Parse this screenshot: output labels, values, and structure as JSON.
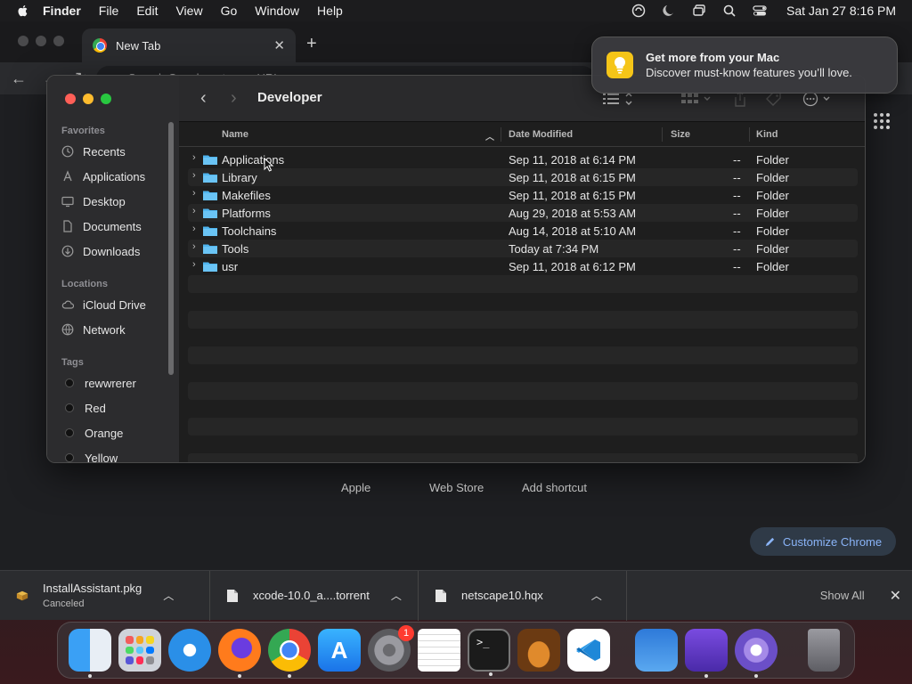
{
  "menubar": {
    "app_name": "Finder",
    "items": [
      "File",
      "Edit",
      "View",
      "Go",
      "Window",
      "Help"
    ],
    "clock": "Sat Jan 27  8:16 PM",
    "status_icons": [
      "vpn-icon",
      "do-not-disturb-icon",
      "screen-mirroring-icon",
      "spotlight-icon",
      "control-center-icon"
    ]
  },
  "chrome": {
    "tab_title": "New Tab",
    "omnibox_placeholder": "Search Google or type a URL",
    "shortcuts": [
      "Apple",
      "Web Store",
      "Add shortcut"
    ],
    "customize_label": "Customize Chrome"
  },
  "notification": {
    "title": "Get more from your Mac",
    "message": "Discover must-know features you’ll love."
  },
  "finder": {
    "window_title": "Developer",
    "sidebar": {
      "favorites_label": "Favorites",
      "favorites": [
        {
          "label": "Recents",
          "icon": "clock-icon"
        },
        {
          "label": "Applications",
          "icon": "applications-icon"
        },
        {
          "label": "Desktop",
          "icon": "desktop-icon"
        },
        {
          "label": "Documents",
          "icon": "document-icon"
        },
        {
          "label": "Downloads",
          "icon": "download-icon"
        }
      ],
      "locations_label": "Locations",
      "locations": [
        {
          "label": "iCloud Drive",
          "icon": "cloud-icon"
        },
        {
          "label": "Network",
          "icon": "network-icon"
        }
      ],
      "tags_label": "Tags",
      "tags": [
        "rewwrerer",
        "Red",
        "Orange",
        "Yellow"
      ]
    },
    "columns": {
      "name": "Name",
      "date": "Date Modified",
      "size": "Size",
      "kind": "Kind"
    },
    "rows": [
      {
        "name": "Applications",
        "date": "Sep 11, 2018 at 6:14 PM",
        "size": "--",
        "kind": "Folder"
      },
      {
        "name": "Library",
        "date": "Sep 11, 2018 at 6:15 PM",
        "size": "--",
        "kind": "Folder"
      },
      {
        "name": "Makefiles",
        "date": "Sep 11, 2018 at 6:15 PM",
        "size": "--",
        "kind": "Folder"
      },
      {
        "name": "Platforms",
        "date": "Aug 29, 2018 at 5:53 AM",
        "size": "--",
        "kind": "Folder"
      },
      {
        "name": "Toolchains",
        "date": "Aug 14, 2018 at 5:10 AM",
        "size": "--",
        "kind": "Folder"
      },
      {
        "name": "Tools",
        "date": "Today at 7:34 PM",
        "size": "--",
        "kind": "Folder"
      },
      {
        "name": "usr",
        "date": "Sep 11, 2018 at 6:12 PM",
        "size": "--",
        "kind": "Folder"
      }
    ]
  },
  "downloads": {
    "items": [
      {
        "name": "InstallAssistant.pkg",
        "status": "Canceled"
      },
      {
        "name": "xcode-10.0_a....torrent",
        "status": ""
      },
      {
        "name": "netscape10.hqx",
        "status": ""
      }
    ],
    "show_all": "Show All"
  },
  "dock": {
    "apps": [
      "Finder",
      "Launchpad",
      "Safari",
      "Firefox",
      "Chrome",
      "App Store",
      "System Settings",
      "TextEdit",
      "Terminal",
      "GarageBand",
      "Visual Studio Code",
      "Weather",
      "Apple Configurator",
      "BitTorrent",
      "Trash"
    ],
    "settings_badge": "1"
  },
  "colors": {
    "accent": "#4fa3e0",
    "traffic_red": "#ff5f57",
    "traffic_yellow": "#febc2e",
    "traffic_green": "#28c840",
    "folder_blue": "#4fb4ee"
  }
}
